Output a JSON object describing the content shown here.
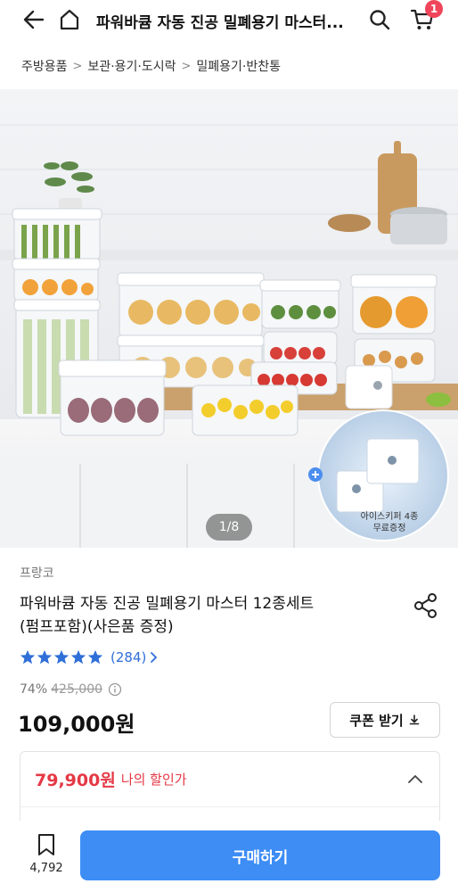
{
  "header": {
    "title": "파워바큠 자동 진공 밀폐용기 마스터...",
    "cart_badge": "1",
    "icons": [
      "back-arrow-icon",
      "home-icon",
      "search-icon",
      "cart-icon"
    ]
  },
  "breadcrumb": [
    "주방용품",
    "보관·용기·도시락",
    "밀폐용기·반찬통"
  ],
  "gallery": {
    "counter": "1/8",
    "promo_caption_line1": "아이스키퍼 4종",
    "promo_caption_line2": "무료증정"
  },
  "product": {
    "brand": "프랑코",
    "name_line1": "파워바큠 자동 진공 밀폐용기 마스터 12종세트",
    "name_line2": "(펌프포함)(사은품 증정)",
    "rating_stars": 5,
    "review_count": "(284)",
    "discount_rate": "74%",
    "original_price": "425,000",
    "price": "109,000원",
    "coupon_label": "쿠폰 받기"
  },
  "my_discount": {
    "price": "79,900원",
    "label": "나의 할인가"
  },
  "bottom": {
    "wish_count": "4,792",
    "buy_label": "구매하기"
  },
  "colors": {
    "accent_blue": "#3d8df5",
    "discount_red": "#e53946",
    "badge_red": "#f0445a",
    "star_blue": "#2f6fd8"
  }
}
